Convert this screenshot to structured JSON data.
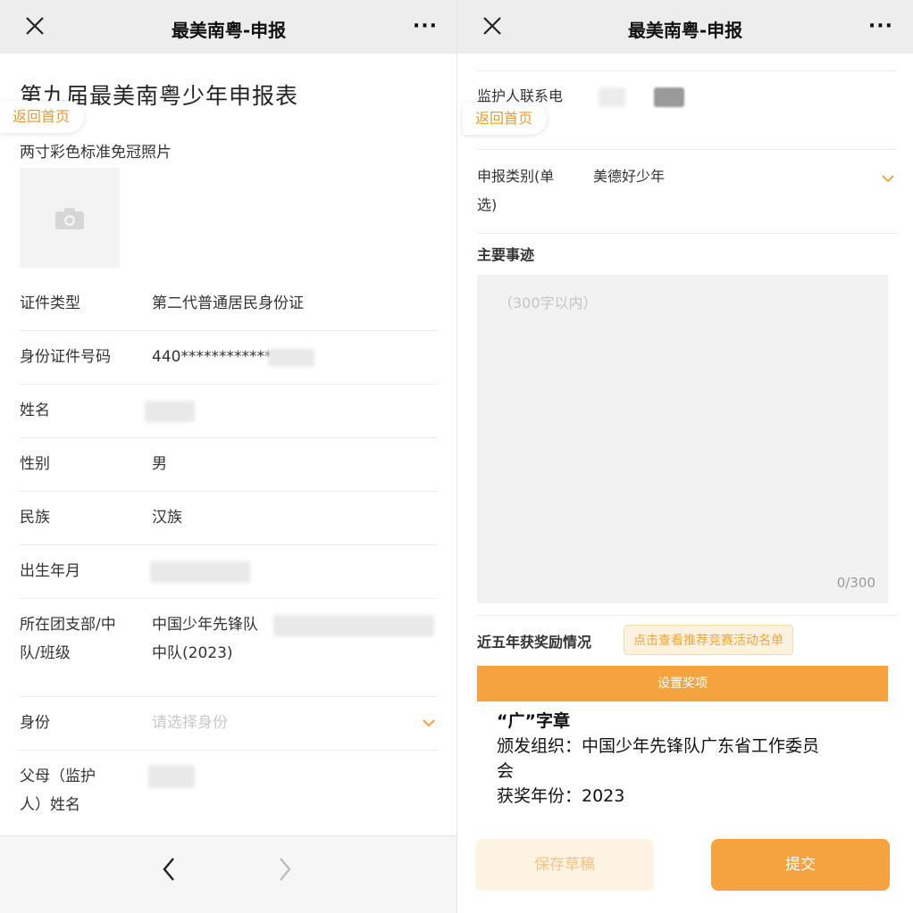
{
  "left": {
    "nav": {
      "title": "最美南粤-申报",
      "more": "···"
    },
    "form_title": "第九届最美南粤少年申报表",
    "home_link": "返回首页",
    "photo_label": "两寸彩色标准免冠照片",
    "fields": [
      {
        "label": "证件类型",
        "value": "第二代普通居民身份证"
      },
      {
        "label": "身份证件号码",
        "value": "440************"
      },
      {
        "label": "姓名",
        "value": ""
      },
      {
        "label": "性别",
        "value": "男"
      },
      {
        "label": "民族",
        "value": "汉族"
      },
      {
        "label": "出生年月",
        "value": ""
      },
      {
        "label_line1": "所在团支部/中",
        "label_line2": "队/班级",
        "value_line1": "中国少年先锋队",
        "value_line2": "中队(2023)"
      },
      {
        "label": "身份",
        "placeholder": "请选择身份"
      },
      {
        "label_line1": "父母（监护",
        "label_line2": "人）姓名",
        "value": ""
      }
    ]
  },
  "right": {
    "nav": {
      "title": "最美南粤-申报",
      "more": "···"
    },
    "home_link": "返回首页",
    "guardian_phone_label": "监护人联系电",
    "category": {
      "label_line1": "申报类别(单",
      "label_line2": "选)",
      "value": "美德好少年"
    },
    "facts": {
      "label": "主要事迹",
      "placeholder": "（300字以内）",
      "counter": "0/300"
    },
    "awards": {
      "label": "近五年获奖励情况",
      "link": "点击查看推荐竞赛活动名单",
      "button": "设置奖项",
      "item": {
        "name": "“广”字章",
        "org_line1": "颁发组织：中国少年先锋队广东省工作委员",
        "org_line2": "会",
        "year": "获奖年份：2023"
      }
    },
    "buttons": {
      "draft": "保存草稿",
      "submit": "提交"
    }
  },
  "colors": {
    "accent": "#f5a33f",
    "link": "#ee9b2c",
    "nav_bg": "#ededed"
  }
}
